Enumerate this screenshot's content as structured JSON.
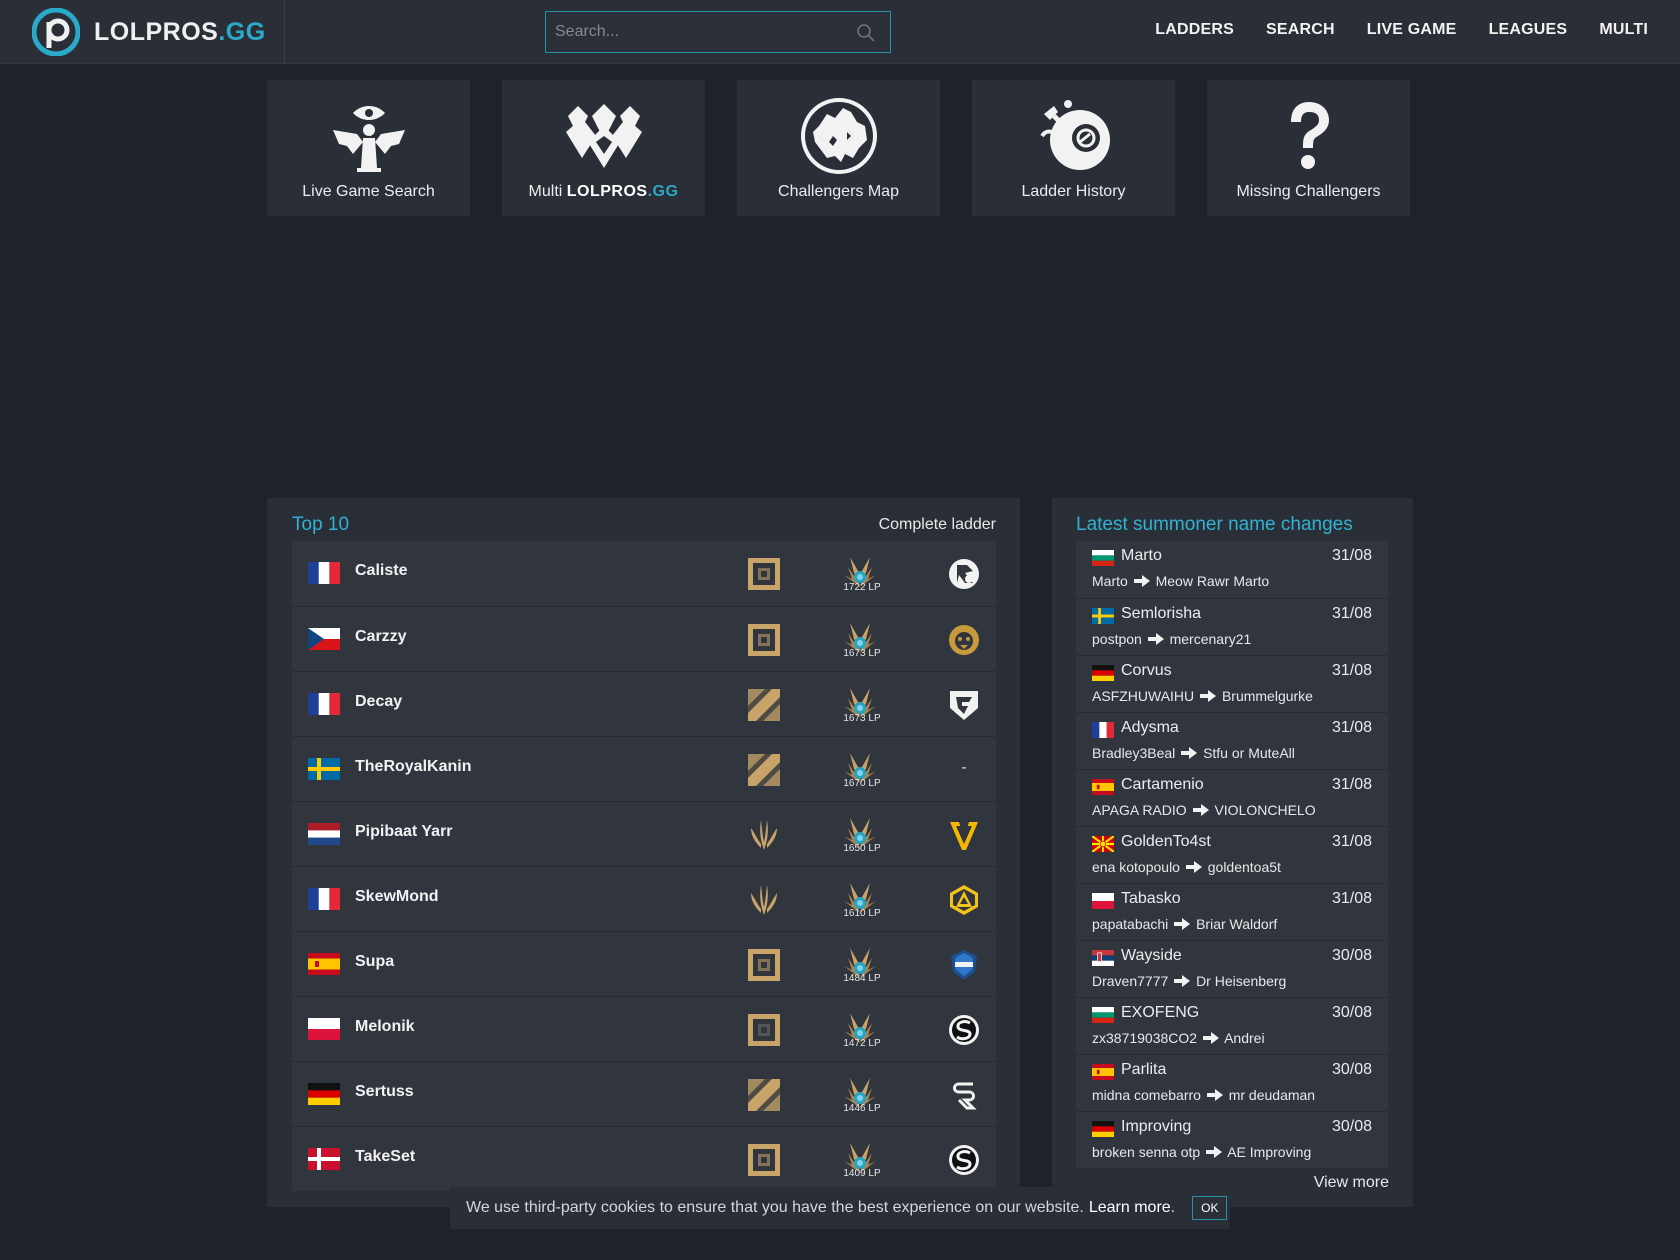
{
  "brand": {
    "name": "LOLPROS",
    "suffix": ".GG",
    "accent": "#2aa9c8"
  },
  "search": {
    "placeholder": "Search..."
  },
  "nav": [
    "LADDERS",
    "SEARCH",
    "LIVE GAME",
    "LEAGUES",
    "MULTI"
  ],
  "tiles": [
    {
      "label": "Live Game Search",
      "icon": "live-game-icon"
    },
    {
      "label_prefix": "Multi ",
      "label_brand": "LOLPROS",
      "label_brand_suffix": ".GG",
      "icon": "multi-icon"
    },
    {
      "label": "Challengers Map",
      "icon": "europe-map-icon"
    },
    {
      "label": "Ladder History",
      "icon": "history-icon"
    },
    {
      "label": "Missing Challengers",
      "icon": "question-icon"
    }
  ],
  "top10": {
    "title": "Top 10",
    "link": "Complete ladder",
    "rows": [
      {
        "name": "Caliste",
        "flag": "fr",
        "role": "adc",
        "lp": "1722 LP",
        "team": "karmine"
      },
      {
        "name": "Carzzy",
        "flag": "cz",
        "role": "adc",
        "lp": "1673 LP",
        "team": "lion"
      },
      {
        "name": "Decay",
        "flag": "fr",
        "role": "mid",
        "lp": "1673 LP",
        "team": "shield"
      },
      {
        "name": "TheRoyalKanin",
        "flag": "se",
        "role": "mid",
        "lp": "1670 LP",
        "team": "-"
      },
      {
        "name": "Pipibaat Yarr",
        "flag": "nl",
        "role": "jungle",
        "lp": "1650 LP",
        "team": "vitality"
      },
      {
        "name": "SkewMond",
        "flag": "fr",
        "role": "jungle",
        "lp": "1610 LP",
        "team": "triangle"
      },
      {
        "name": "Supa",
        "flag": "es",
        "role": "adc",
        "lp": "1484 LP",
        "team": "riders"
      },
      {
        "name": "Melonik",
        "flag": "pl",
        "role": "support",
        "lp": "1472 LP",
        "team": "s-circle"
      },
      {
        "name": "Sertuss",
        "flag": "de",
        "role": "mid",
        "lp": "1446 LP",
        "team": "sk"
      },
      {
        "name": "TakeSet",
        "flag": "dk",
        "role": "adc",
        "lp": "1409 LP",
        "team": "s-circle"
      }
    ]
  },
  "changes": {
    "title": "Latest summoner name changes",
    "items": [
      {
        "name": "Marto",
        "date": "31/08",
        "flag": "bg",
        "from": "Marto",
        "to": "Meow Rawr Marto"
      },
      {
        "name": "Semlorisha",
        "date": "31/08",
        "flag": "se",
        "from": "postpon",
        "to": "mercenary21"
      },
      {
        "name": "Corvus",
        "date": "31/08",
        "flag": "de",
        "from": "ASFZHUWAIHU",
        "to": "Brummelgurke"
      },
      {
        "name": "Adysma",
        "date": "31/08",
        "flag": "fr",
        "from": "Bradley3Beal",
        "to": "Stfu or MuteAll"
      },
      {
        "name": "Cartamenio",
        "date": "31/08",
        "flag": "es",
        "from": "APAGA RADIO",
        "to": "VIOLONCHELO"
      },
      {
        "name": "GoldenTo4st",
        "date": "31/08",
        "flag": "mk",
        "from": "ena kotopoulo",
        "to": "goldentoa5t"
      },
      {
        "name": "Tabasko",
        "date": "31/08",
        "flag": "pl",
        "from": "papatabachi",
        "to": "Briar Waldorf"
      },
      {
        "name": "Wayside",
        "date": "30/08",
        "flag": "rs",
        "from": "Draven7777",
        "to": "Dr Heisenberg"
      },
      {
        "name": "EXOFENG",
        "date": "30/08",
        "flag": "bg",
        "from": "zx38719038CO2",
        "to": "Andrei"
      },
      {
        "name": "Parlita",
        "date": "30/08",
        "flag": "es",
        "from": "midna comebarro",
        "to": "mr deudaman"
      },
      {
        "name": "Improving",
        "date": "30/08",
        "flag": "de",
        "from": "broken senna otp",
        "to": "AE Improving"
      }
    ],
    "view_more": "View more"
  },
  "cookie": {
    "text": "We use third-party cookies to ensure that you have the best experience on our website.",
    "link": "Learn more",
    "suffix": ".",
    "button": "OK"
  }
}
